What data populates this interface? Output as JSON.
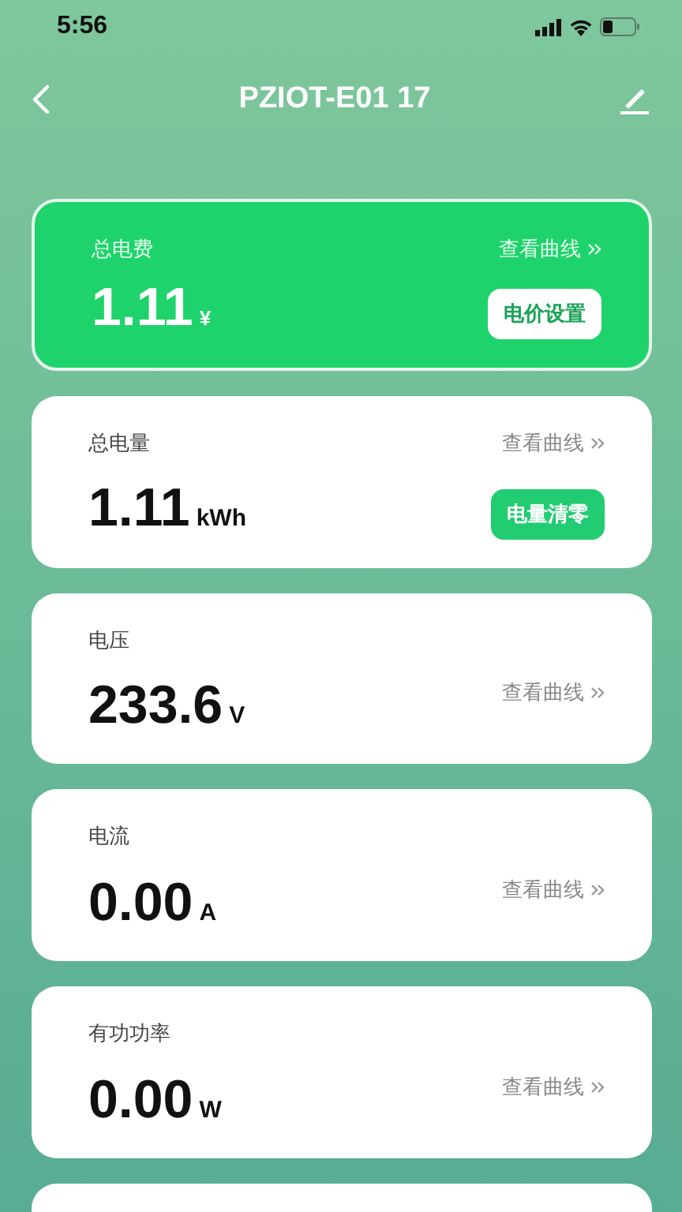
{
  "status_bar": {
    "time": "5:56"
  },
  "header": {
    "title": "PZIOT-E01 17"
  },
  "metrics": [
    {
      "kind": "highlight",
      "label": "总电费",
      "value": "1.11",
      "unit": "¥",
      "link": "查看曲线",
      "button": "电价设置"
    },
    {
      "kind": "plain",
      "label": "总电量",
      "value": "1.11",
      "unit": "kWh",
      "link": "查看曲线",
      "button": "电量清零"
    },
    {
      "kind": "plain",
      "label": "电压",
      "value": "233.6",
      "unit": "V",
      "link": "查看曲线"
    },
    {
      "kind": "plain",
      "label": "电流",
      "value": "0.00",
      "unit": "A",
      "link": "查看曲线"
    },
    {
      "kind": "plain",
      "label": "有功功率",
      "value": "0.00",
      "unit": "W",
      "link": "查看曲线"
    }
  ],
  "partial_card": true
}
